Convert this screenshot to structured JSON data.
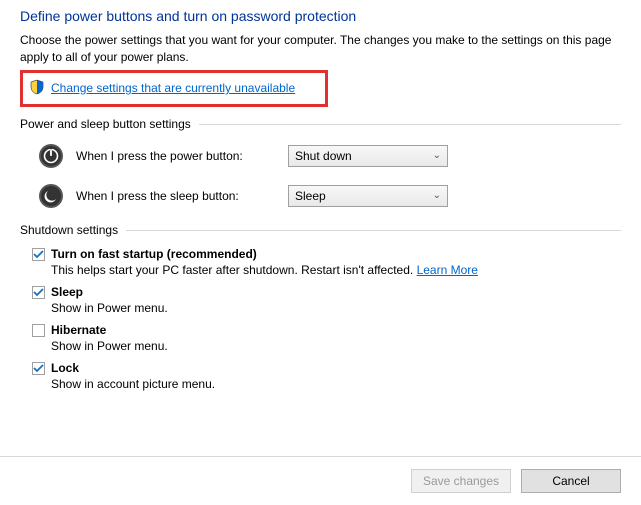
{
  "title": "Define power buttons and turn on password protection",
  "subtitle": "Choose the power settings that you want for your computer. The changes you make to the settings on this page apply to all of your power plans.",
  "change_link": "Change settings that are currently unavailable",
  "sections": {
    "buttons_header": "Power and sleep button settings",
    "power_button_label": "When I press the power button:",
    "power_button_value": "Shut down",
    "sleep_button_label": "When I press the sleep button:",
    "sleep_button_value": "Sleep",
    "shutdown_header": "Shutdown settings"
  },
  "shutdown": [
    {
      "label": "Turn on fast startup (recommended)",
      "desc_prefix": "This helps start your PC faster after shutdown. Restart isn't affected. ",
      "learn_more": "Learn More",
      "checked": true
    },
    {
      "label": "Sleep",
      "desc": "Show in Power menu.",
      "checked": true
    },
    {
      "label": "Hibernate",
      "desc": "Show in Power menu.",
      "checked": false
    },
    {
      "label": "Lock",
      "desc": "Show in account picture menu.",
      "checked": true
    }
  ],
  "buttons": {
    "save": "Save changes",
    "cancel": "Cancel"
  }
}
